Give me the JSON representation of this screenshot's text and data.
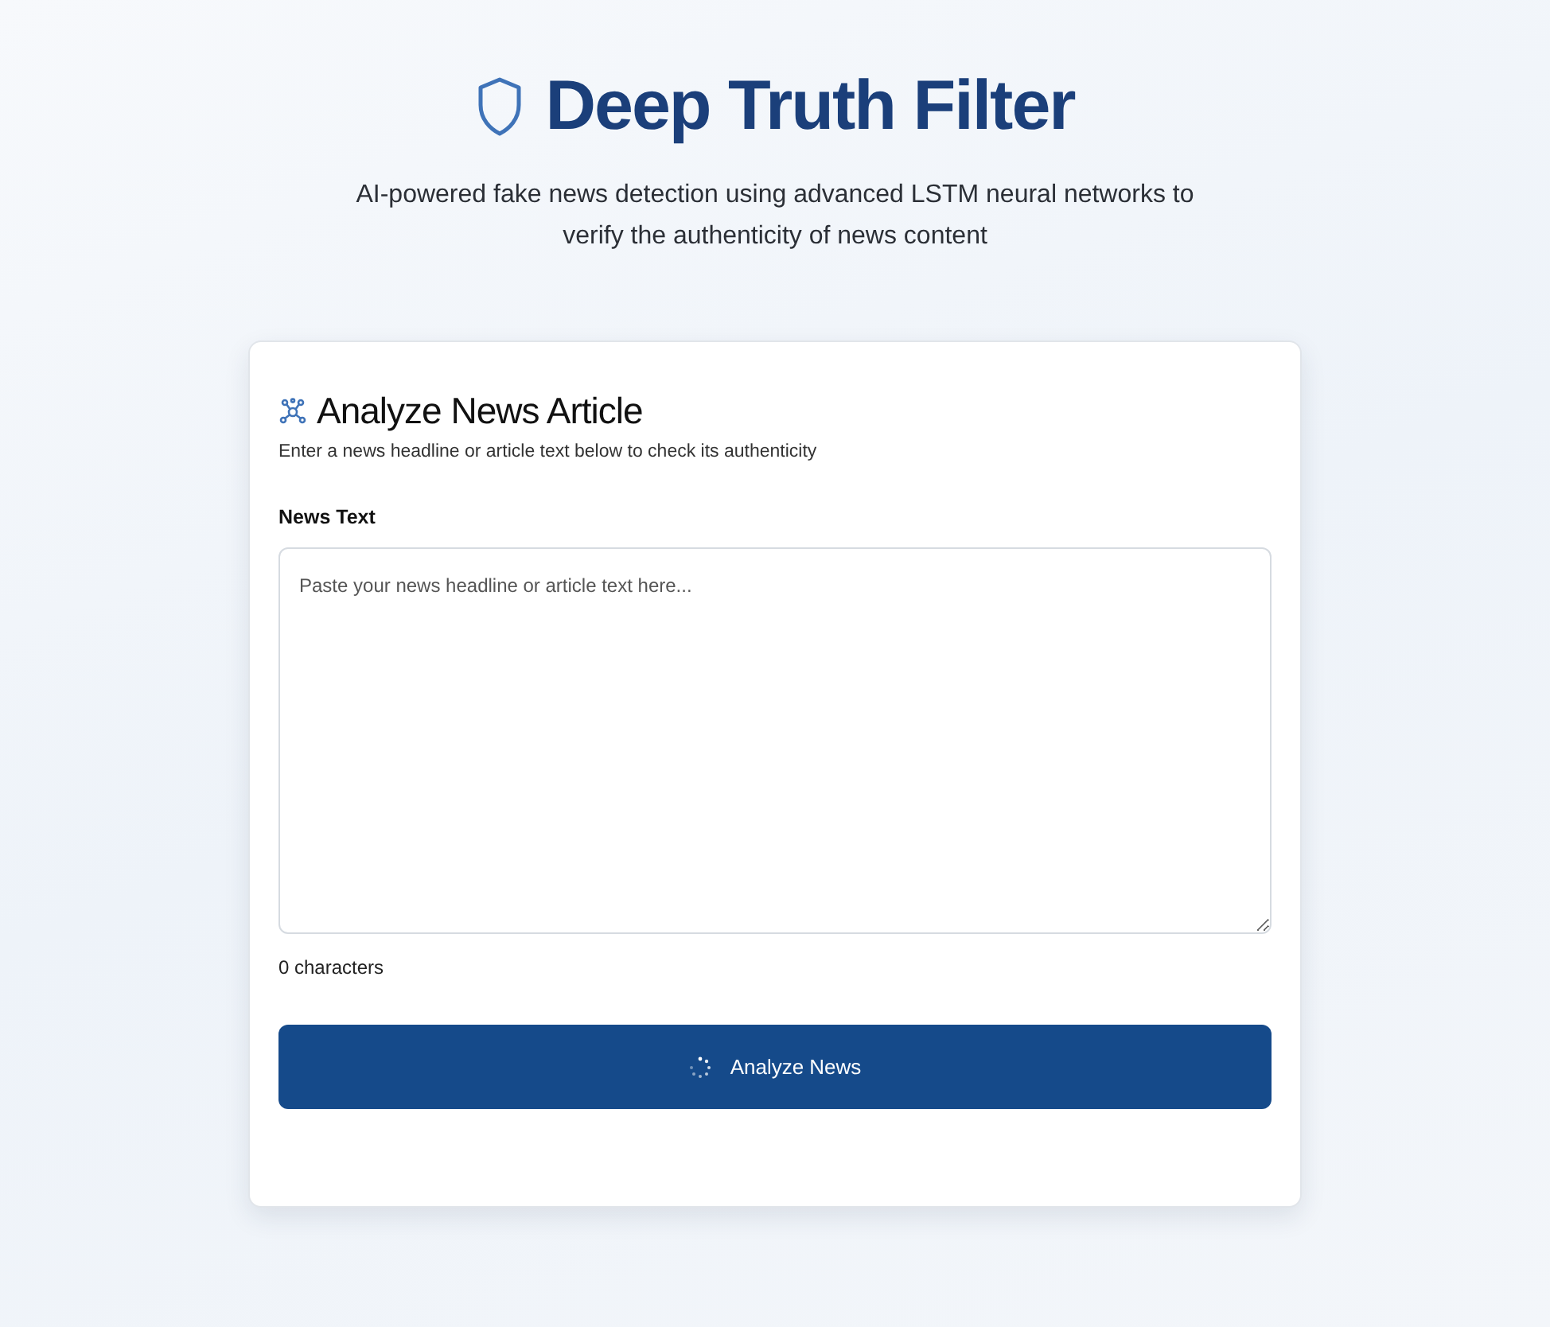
{
  "header": {
    "title": "Deep Truth Filter",
    "subtitle": "AI-powered fake news detection using advanced LSTM neural networks to verify the authenticity of news content"
  },
  "card": {
    "title": "Analyze News Article",
    "description": "Enter a news headline or article text below to check its authenticity",
    "field": {
      "label": "News Text",
      "placeholder": "Paste your news headline or article text here..."
    },
    "char_count": "0 characters",
    "button": {
      "label": "Analyze News",
      "loading": true
    }
  }
}
